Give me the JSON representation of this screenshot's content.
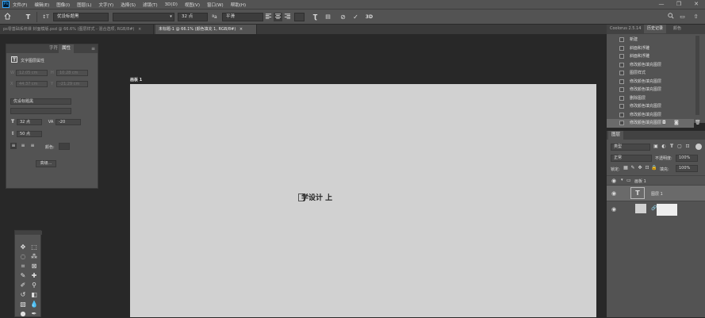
{
  "menubar": {
    "app_icon": "Ps",
    "items": [
      "文件(F)",
      "编辑(E)",
      "图像(I)",
      "图层(L)",
      "文字(Y)",
      "选择(S)",
      "滤镜(T)",
      "3D(D)",
      "视图(V)",
      "窗口(W)",
      "帮助(H)"
    ],
    "min_glyph": "—",
    "max_glyph": "❐",
    "close_glyph": "✕"
  },
  "options": {
    "font_family": "优设标题黑",
    "font_style": "",
    "font_size": "32 点",
    "antialias": "平滑",
    "three_d": "3D",
    "cancel_glyph": "⊘",
    "commit_glyph": "✓"
  },
  "tabs": [
    {
      "label": "ps零基础系统课 封面模版.psd @ 66.6% (图层样式 - 混合选项, RGB/8#)",
      "close": "×"
    },
    {
      "label": "未标题-1 @ 66.1% (颜色填充 1, RGB/8#)",
      "close": "×"
    }
  ],
  "artboard": {
    "label": "画板 1",
    "text": "学设计 上"
  },
  "char_panel": {
    "tabs": [
      "字符",
      "属性"
    ],
    "header": "文字图层属性",
    "dim_fields": [
      "12.05 cm",
      "10.28 cm",
      "44.37 cm",
      "-21.29 cm"
    ],
    "font_family": "优设标题黑",
    "font_size": "32 点",
    "tracking": "-20",
    "leading": "50 点",
    "color_label": "颜色:",
    "advanced_button": "高级..."
  },
  "history": {
    "tabs": [
      "Coolorus 2.5.14",
      "历史记录",
      "颜色"
    ],
    "items": [
      "新建",
      "斜面和浮雕",
      "斜面和浮雕",
      "修改颜色填充图层",
      "图层样式",
      "修改颜色填充图层",
      "修改颜色填充图层",
      "删除图层",
      "修改颜色填充图层",
      "修改颜色填充图层",
      "修改颜色填充图层"
    ]
  },
  "layers": {
    "tab": "图层",
    "search_placeholder": "类型",
    "blend_mode": "正常",
    "opacity_label": "不透明度:",
    "opacity": "100%",
    "lock_label": "锁定:",
    "fill_label": "填充:",
    "fill": "100%",
    "group_name": "画板 1",
    "text_layer_name": "图层 1"
  },
  "colors": {
    "accent": "#31a8ff",
    "panel": "#535353",
    "canvas_bg": "#282828",
    "artboard": "#d1d1d1"
  }
}
